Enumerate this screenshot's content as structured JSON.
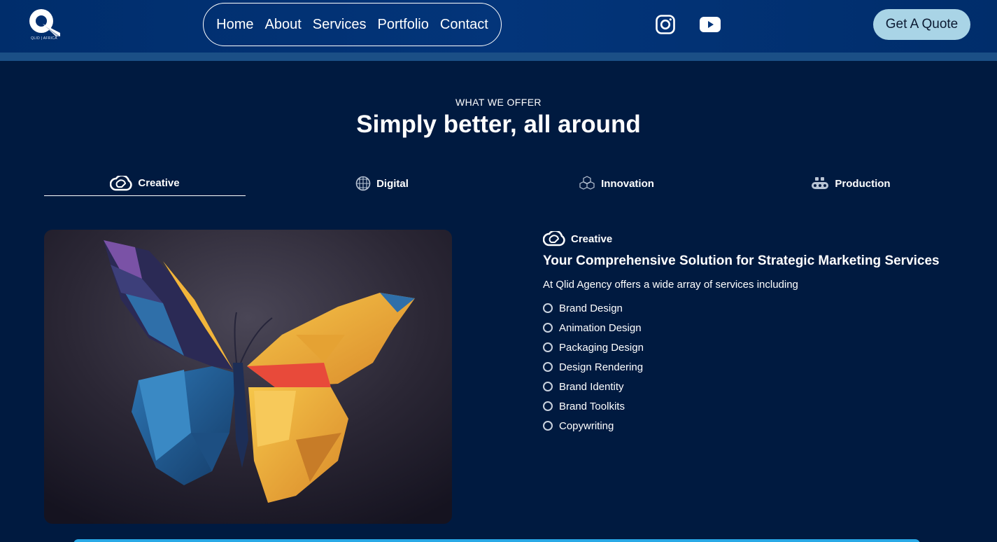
{
  "brand": {
    "logo_letter": "Q",
    "logo_tagline": "QLID | AFRICA"
  },
  "nav": {
    "items": [
      {
        "label": "Home"
      },
      {
        "label": "About"
      },
      {
        "label": "Services"
      },
      {
        "label": "Portfolio"
      },
      {
        "label": "Contact"
      }
    ]
  },
  "social": {
    "instagram_icon": "instagram-icon",
    "youtube_icon": "youtube-icon"
  },
  "cta": {
    "label": "Get A Quote"
  },
  "section": {
    "eyebrow": "WHAT WE OFFER",
    "headline": "Simply better, all around"
  },
  "tabs": [
    {
      "label": "Creative",
      "icon": "creative-cloud-icon",
      "active": true
    },
    {
      "label": "Digital",
      "icon": "globe-grid-icon",
      "active": false
    },
    {
      "label": "Innovation",
      "icon": "cubes-icon",
      "active": false
    },
    {
      "label": "Production",
      "icon": "conveyor-icon",
      "active": false
    }
  ],
  "content": {
    "tag": "Creative",
    "title": "Your Comprehensive Solution for Strategic Marketing Services",
    "intro": "At Qlid Agency offers a wide array of services including",
    "services": [
      "Brand Design",
      "Animation Design",
      "Packaging Design",
      "Design Rendering",
      "Brand Identity",
      "Brand Toolkits",
      "Copywriting"
    ]
  },
  "colors": {
    "background": "#001a40",
    "header": "#03357a",
    "header_strip": "#1b4f86",
    "cta_bg": "#a9d4e6",
    "accent_bar": "#29a9e6"
  }
}
